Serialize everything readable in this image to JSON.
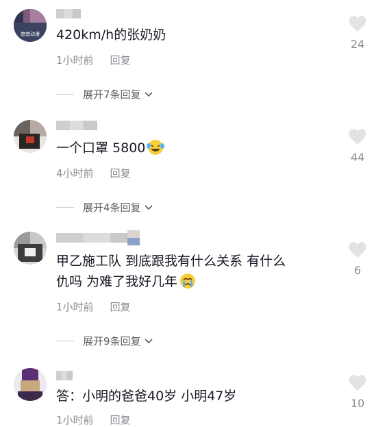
{
  "comments": [
    {
      "avatar_text": "悠悠动漫",
      "text": "420km/h的张奶奶",
      "time": "1小时前",
      "reply_label": "回复",
      "expand_label": "展开7条回复",
      "likes": "24",
      "avatar_icon": "user-avatar"
    },
    {
      "text": "一个口罩 5800",
      "emoji": "laughing-tears-emoji",
      "time": "4小时前",
      "reply_label": "回复",
      "expand_label": "展开4条回复",
      "likes": "44",
      "avatar_icon": "user-avatar"
    },
    {
      "text_line1": "甲乙施工队 到底跟我有什么关系 有什么",
      "text_line2": "仇吗 为难了我好几年",
      "emoji": "crying-emoji",
      "time": "1小时前",
      "reply_label": "回复",
      "expand_label": "展开9条回复",
      "likes": "6",
      "avatar_icon": "user-avatar"
    },
    {
      "text": "答：小明的爸爸40岁 小明47岁",
      "time": "1小时前",
      "reply_label": "回复",
      "likes": "10",
      "avatar_icon": "user-avatar"
    }
  ],
  "icons": {
    "like": "heart-icon",
    "expand": "chevron-down-icon"
  },
  "colors": {
    "secondary_text": "#8a8b91",
    "heart": "#e3e3e6",
    "text": "#161823"
  }
}
